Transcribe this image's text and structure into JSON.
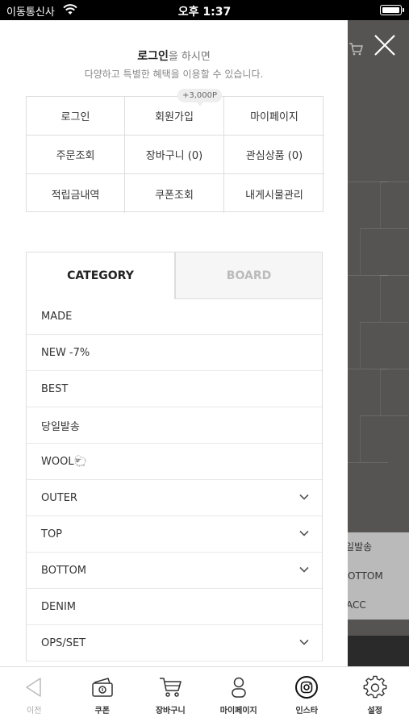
{
  "status_bar": {
    "carrier": "이동통신사",
    "time": "오후 1:37"
  },
  "login_prompt": {
    "bold": "로그인",
    "rest": "을 하시면",
    "subtitle": "다양하고 특별한 혜택을 이용할 수 있습니다."
  },
  "signup_badge": "+3,000P",
  "account_grid": [
    {
      "label": "로그인"
    },
    {
      "label": "회원가입"
    },
    {
      "label": "마이페이지"
    },
    {
      "label": "주문조회"
    },
    {
      "label": "장바구니 (0)"
    },
    {
      "label": "관심상품 (0)"
    },
    {
      "label": "적립금내역"
    },
    {
      "label": "쿠폰조회"
    },
    {
      "label": "내게시물관리"
    }
  ],
  "tabs": {
    "category": "CATEGORY",
    "board": "BOARD"
  },
  "categories": [
    {
      "label": "MADE",
      "expandable": false
    },
    {
      "label": "NEW -7%",
      "expandable": false
    },
    {
      "label": "BEST",
      "expandable": false
    },
    {
      "label": "당일발송",
      "expandable": false
    },
    {
      "label": "WOOL🐑",
      "expandable": false
    },
    {
      "label": "OUTER",
      "expandable": true
    },
    {
      "label": "TOP",
      "expandable": true
    },
    {
      "label": "BOTTOM",
      "expandable": true
    },
    {
      "label": "DENIM",
      "expandable": false
    },
    {
      "label": "OPS/SET",
      "expandable": true
    }
  ],
  "background_menu": [
    "당일발송",
    "BOTTOM",
    "ACC"
  ],
  "bottom_bar": [
    {
      "label": "이전",
      "icon": "back-arrow-icon"
    },
    {
      "label": "쿠폰",
      "icon": "coupon-icon"
    },
    {
      "label": "장바구니",
      "icon": "cart-icon"
    },
    {
      "label": "마이페이지",
      "icon": "person-icon"
    },
    {
      "label": "인스타",
      "icon": "instagram-icon"
    },
    {
      "label": "설정",
      "icon": "gear-icon"
    }
  ]
}
